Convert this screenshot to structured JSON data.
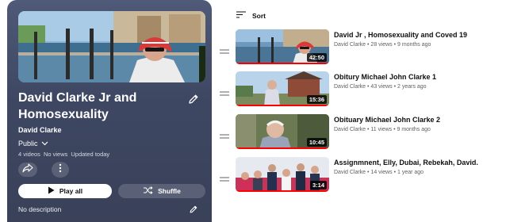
{
  "playlist": {
    "title": "David Clarke Jr and Homosexuality",
    "owner": "David Clarke",
    "privacy": "Public",
    "video_count": "4 videos",
    "views": "No views",
    "updated": "Updated today",
    "play_all_label": "Play all",
    "shuffle_label": "Shuffle",
    "description": "No description"
  },
  "sort": {
    "label": "Sort"
  },
  "videos": [
    {
      "title": "David Jr , Homosexuality and Coved 19",
      "channel": "David Clarke",
      "views": "28 views",
      "age": "9 months ago",
      "duration": "42:50"
    },
    {
      "title": "Obitury Michael John Clarke 1",
      "channel": "David Clarke",
      "views": "43 views",
      "age": "2 years ago",
      "duration": "15:36"
    },
    {
      "title": "Obituary Michael John Clarke 2",
      "channel": "David Clarke",
      "views": "11 views",
      "age": "9 months ago",
      "duration": "10:45"
    },
    {
      "title": "Assignmnent, Elly, Dubai, Rebekah, David.",
      "channel": "David Clarke",
      "views": "14 views",
      "age": "1 year ago",
      "duration": "3:14"
    }
  ],
  "icons": {
    "edit": "pencil-icon",
    "privacy_toggle": "chevron-down-icon",
    "share": "share-icon",
    "more": "more-vert-icon",
    "play": "play-icon",
    "shuffle": "shuffle-icon",
    "sort": "sort-icon",
    "drag": "drag-handle-icon"
  },
  "colors": {
    "panel": "#444d6a",
    "progress_red": "#ff0000",
    "text_primary": "#0f0f0f",
    "text_secondary": "#606060"
  }
}
